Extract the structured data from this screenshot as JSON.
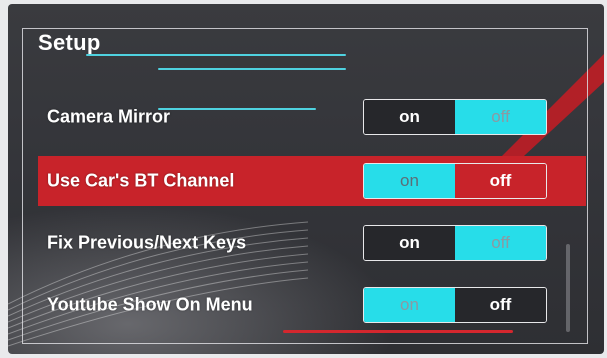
{
  "header": {
    "title": "Setup"
  },
  "settings": [
    {
      "label": "Camera Mirror",
      "on_label": "on",
      "off_label": "off",
      "value": "on",
      "selected": false
    },
    {
      "label": "Use Car's BT Channel",
      "on_label": "on",
      "off_label": "off",
      "value": "off",
      "selected": true
    },
    {
      "label": "Fix Previous/Next Keys",
      "on_label": "on",
      "off_label": "off",
      "value": "on",
      "selected": false
    },
    {
      "label": "Youtube Show On Menu",
      "on_label": "on",
      "off_label": "off",
      "value": "off",
      "selected": false
    }
  ],
  "colors": {
    "background": "#34353a",
    "highlight_red": "#c8232a",
    "toggle_cyan": "#27dde9",
    "toggle_dark": "#26272b",
    "accent_line": "#4fd2e0"
  }
}
